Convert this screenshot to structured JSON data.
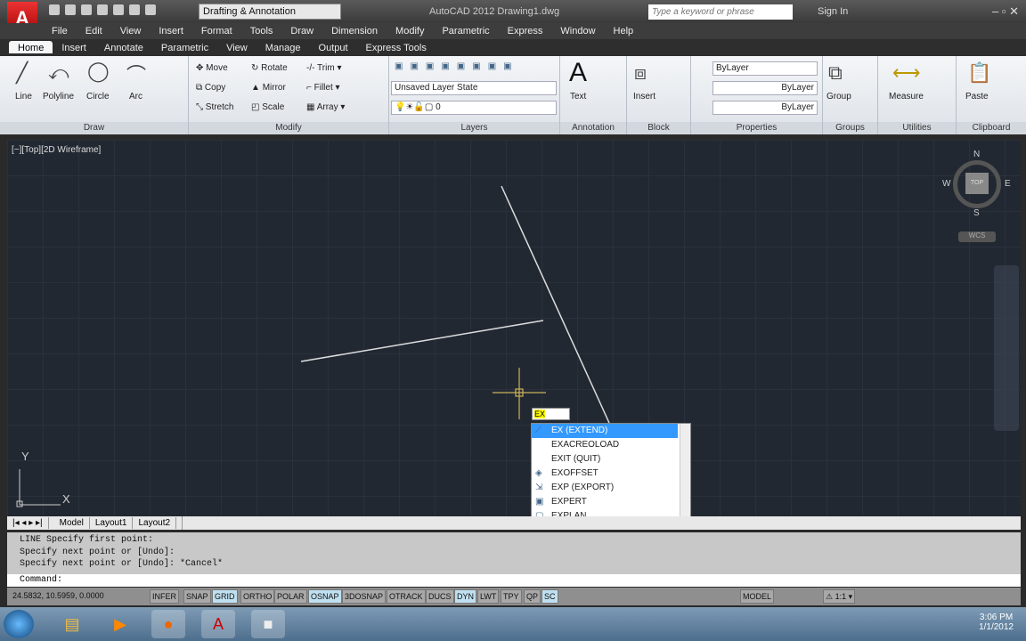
{
  "titlebar": {
    "workspace": "Drafting & Annotation",
    "title": "AutoCAD 2012   Drawing1.dwg",
    "search_placeholder": "Type a keyword or phrase",
    "sign_in": "Sign In"
  },
  "menu": [
    "File",
    "Edit",
    "View",
    "Insert",
    "Format",
    "Tools",
    "Draw",
    "Dimension",
    "Modify",
    "Parametric",
    "Express",
    "Window",
    "Help"
  ],
  "tabs": [
    "Home",
    "Insert",
    "Annotate",
    "Parametric",
    "View",
    "Manage",
    "Output",
    "Express Tools"
  ],
  "ribbon": {
    "draw": {
      "label": "Draw",
      "tools": [
        "Line",
        "Polyline",
        "Circle",
        "Arc"
      ]
    },
    "modify": {
      "label": "Modify",
      "tools": [
        "Move",
        "Rotate",
        "Trim",
        "Copy",
        "Mirror",
        "Fillet",
        "Stretch",
        "Scale",
        "Array"
      ]
    },
    "layers": {
      "label": "Layers",
      "layer_state": "Unsaved Layer State",
      "current_layer": "0"
    },
    "annotation": {
      "label": "Annotation",
      "text": "Text"
    },
    "block": {
      "label": "Block",
      "insert": "Insert"
    },
    "properties": {
      "label": "Properties",
      "color": "ByLayer",
      "linetype": "ByLayer",
      "lineweight": "ByLayer"
    },
    "groups": {
      "label": "Groups",
      "group": "Group"
    },
    "utilities": {
      "label": "Utilities",
      "measure": "Measure"
    },
    "clipboard": {
      "label": "Clipboard",
      "paste": "Paste"
    }
  },
  "viewport": {
    "label": "[−][Top][2D Wireframe]",
    "compass": {
      "n": "N",
      "s": "S",
      "e": "E",
      "w": "W",
      "top": "TOP"
    },
    "wcs": "WCS",
    "ucs_x": "X",
    "ucs_y": "Y"
  },
  "dynamic_input": "EX",
  "autocomplete": [
    "EX (EXTEND)",
    "EXACREOLOAD",
    "EXIT (QUIT)",
    "EXOFFSET",
    "EXP (EXPORT)",
    "EXPERT",
    "EXPLAN"
  ],
  "layout_tabs": [
    "Model",
    "Layout1",
    "Layout2"
  ],
  "command_history": [
    "LINE Specify first point:",
    "Specify next point or [Undo]:",
    "Specify next point or [Undo]: *Cancel*"
  ],
  "command_prompt": "Command:",
  "status": {
    "coords": "24.5832, 10.5959, 0.0000",
    "toggles": [
      {
        "label": "INFER",
        "on": false
      },
      {
        "label": "SNAP",
        "on": false
      },
      {
        "label": "GRID",
        "on": true
      },
      {
        "label": "ORTHO",
        "on": false
      },
      {
        "label": "POLAR",
        "on": false
      },
      {
        "label": "OSNAP",
        "on": true
      },
      {
        "label": "3DOSNAP",
        "on": false
      },
      {
        "label": "OTRACK",
        "on": false
      },
      {
        "label": "DUCS",
        "on": false
      },
      {
        "label": "DYN",
        "on": true
      },
      {
        "label": "LWT",
        "on": false
      },
      {
        "label": "TPY",
        "on": false
      },
      {
        "label": "QP",
        "on": false
      },
      {
        "label": "SC",
        "on": true
      }
    ],
    "model": "MODEL",
    "scale": "1:1"
  },
  "taskbar": {
    "time": "3:06 PM",
    "date": "1/1/2012"
  }
}
